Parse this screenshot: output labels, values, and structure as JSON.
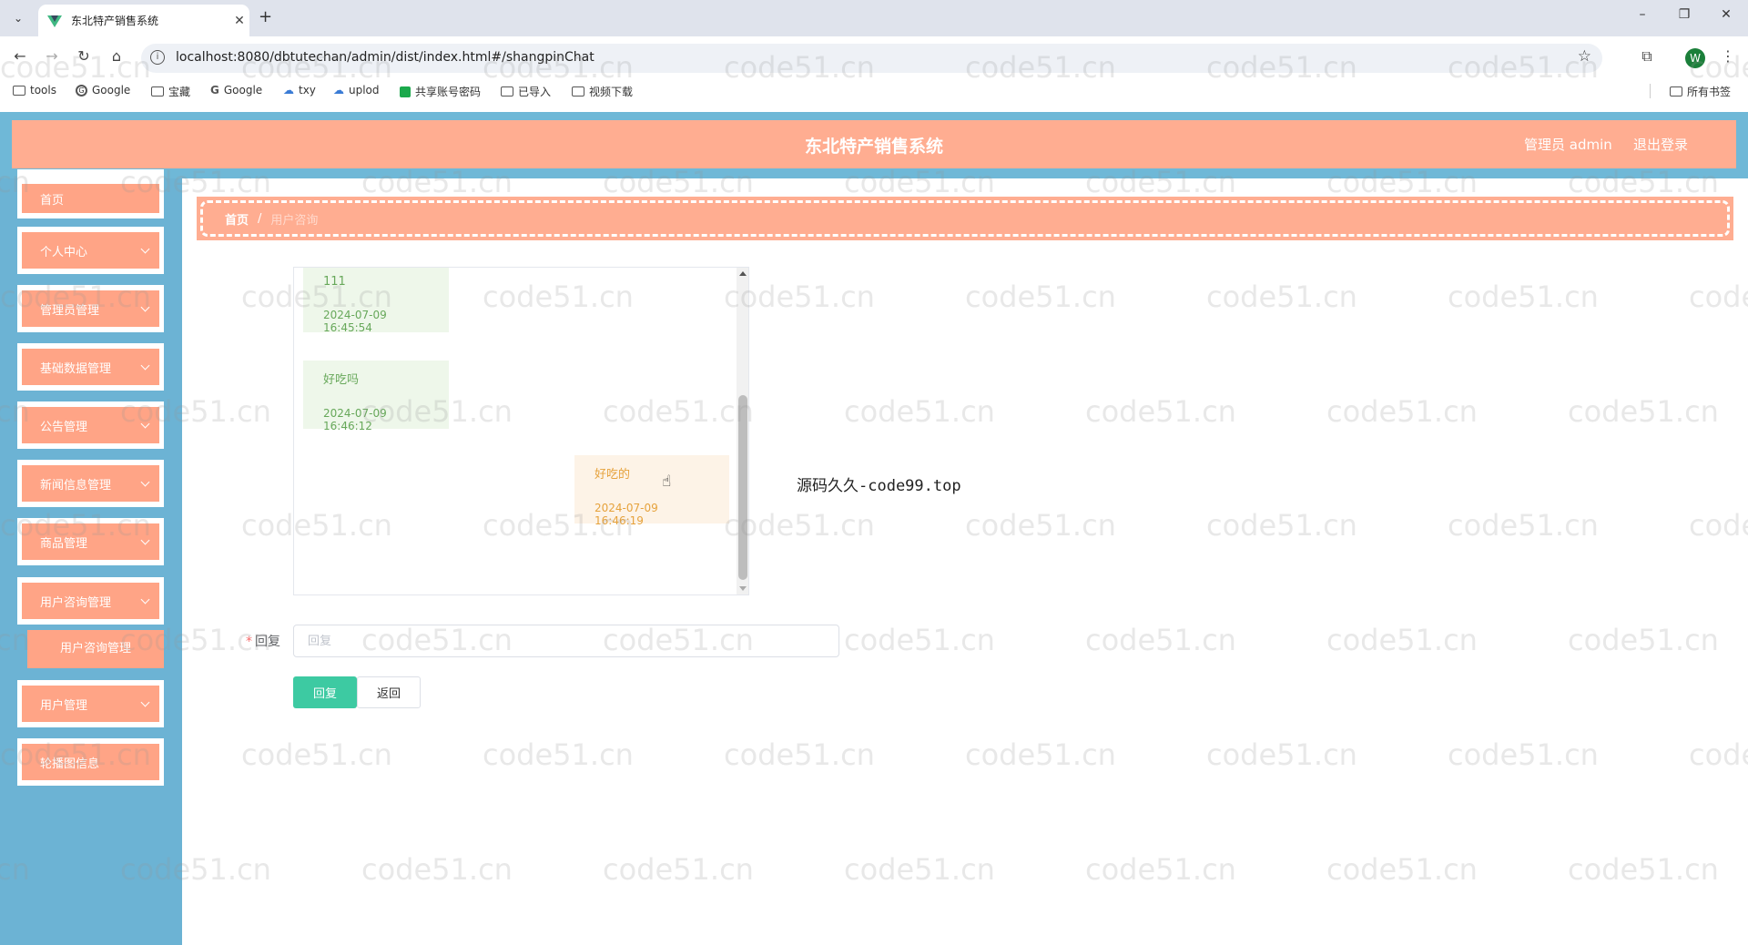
{
  "browser": {
    "tab_title": "东北特产销售系统",
    "url": "localhost:8080/dbtutechan/admin/dist/index.html#/shangpinChat",
    "profile_initial": "W",
    "bookmarks": [
      "tools",
      "Google",
      "宝藏",
      "Google",
      "txy",
      "uplod",
      "共享账号密码",
      "已导入",
      "视频下载"
    ],
    "all_bookmarks": "所有书签"
  },
  "header": {
    "title": "东北特产销售系统",
    "role": "管理员 admin",
    "logout": "退出登录"
  },
  "sidebar": {
    "items": [
      {
        "label": "首页",
        "has_arrow": false
      },
      {
        "label": "个人中心",
        "has_arrow": true
      },
      {
        "label": "管理员管理",
        "has_arrow": true
      },
      {
        "label": "基础数据管理",
        "has_arrow": true
      },
      {
        "label": "公告管理",
        "has_arrow": true
      },
      {
        "label": "新闻信息管理",
        "has_arrow": true
      },
      {
        "label": "商品管理",
        "has_arrow": true
      },
      {
        "label": "用户咨询管理",
        "has_arrow": true
      },
      {
        "label": "用户管理",
        "has_arrow": true
      },
      {
        "label": "轮播图信息",
        "has_arrow": false
      }
    ],
    "submenu_label": "用户咨询管理"
  },
  "breadcrumb": {
    "home": "首页",
    "separator": "/",
    "current": "用户咨询"
  },
  "chat": {
    "messages": [
      {
        "side": "left",
        "text": "111",
        "time": "2024-07-09 16:45:54"
      },
      {
        "side": "left",
        "text": "好吃吗",
        "time": "2024-07-09 16:46:12"
      },
      {
        "side": "right",
        "text": "好吃的",
        "time": "2024-07-09 16:46:19"
      }
    ]
  },
  "overlay_text": "源码久久-code99.top",
  "watermark_text": "code51.cn",
  "form": {
    "label": "回复",
    "required_mark": "*",
    "placeholder": "回复",
    "value": ""
  },
  "buttons": {
    "reply": "回复",
    "back": "返回"
  },
  "colors": {
    "header": "#ffad91",
    "sidebar": "#6cb3d4",
    "menu": "#ffa486",
    "reply_button": "#3dcaa2"
  },
  "icons": [
    "tab-list-icon",
    "vue-favicon",
    "close-icon",
    "plus-icon",
    "back-icon",
    "forward-icon",
    "reload-icon",
    "home-icon",
    "info-icon",
    "star-icon",
    "extensions-icon",
    "menu-dots-icon",
    "folder-icon",
    "chevron-down-icon",
    "hand-cursor-icon"
  ]
}
